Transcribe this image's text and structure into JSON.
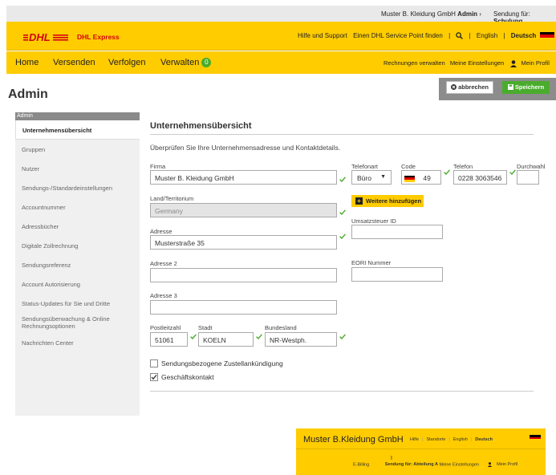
{
  "topbar": {
    "company_name": "Muster B. Kleidung GmbH",
    "company_role": "Admin",
    "chev": "›",
    "sendung_label": "Sendung für:",
    "sendung_value": "Schulung",
    "sendung_chev": "⌄"
  },
  "brand": {
    "product": "DHL Express",
    "links": {
      "help": "Hilfe und Support",
      "service_point": "Einen DHL Service Point finden",
      "sep": "|",
      "english": "English",
      "deutsch": "Deutsch"
    }
  },
  "nav": {
    "items": [
      {
        "label": "Home"
      },
      {
        "label": "Versenden"
      },
      {
        "label": "Verfolgen"
      },
      {
        "label": "Verwalten"
      }
    ],
    "badge": "0",
    "right": {
      "invoices": "Rechnungen verwalten",
      "settings": "Meine Einstellungen",
      "profile": "Mein Profil"
    }
  },
  "page": {
    "title": "Admin"
  },
  "actions": {
    "cancel": "abbrechen",
    "save": "Speichern"
  },
  "sidebar": {
    "header": "Admin",
    "items": [
      {
        "label": "Unternehmensübersicht"
      },
      {
        "label": "Gruppen"
      },
      {
        "label": "Nutzer"
      },
      {
        "label": "Sendungs-/Standardeinstellungen"
      },
      {
        "label": "Accountnummer"
      },
      {
        "label": "Adressbücher"
      },
      {
        "label": "Digitale Zollrechnung"
      },
      {
        "label": "Sendungsreferenz"
      },
      {
        "label": "Account Autorisierung"
      },
      {
        "label": "Status-Updates für Sie und Dritte"
      },
      {
        "label": "Sendungsüberwachung & Online Rechnungsoptionen"
      },
      {
        "label": "Nachrichten Center"
      }
    ]
  },
  "form": {
    "title": "Unternehmensübersicht",
    "intro": "Überprüfen Sie Ihre Unternehmensadresse und Kontaktdetails.",
    "firma": {
      "label": "Firma",
      "value": "Muster B. Kleidung GmbH"
    },
    "land": {
      "label": "Land/Territorium",
      "value": "Germany"
    },
    "adresse": {
      "label": "Adresse",
      "value": "Musterstraße 35"
    },
    "adresse2": {
      "label": "Adresse 2",
      "value": ""
    },
    "adresse3": {
      "label": "Adresse 3",
      "value": ""
    },
    "plz": {
      "label": "Postleitzahl",
      "value": "51061"
    },
    "stadt": {
      "label": "Stadt",
      "value": "KOELN"
    },
    "bundesland": {
      "label": "Bundesland",
      "value": "NR-Westph."
    },
    "telefonart": {
      "label": "Telefonart",
      "value": "Büro"
    },
    "code": {
      "label": "Code",
      "value": "49"
    },
    "telefon": {
      "label": "Telefon",
      "value": "0228 3063546"
    },
    "durchwahl": {
      "label": "Durchwahl",
      "value": ""
    },
    "add_more": "Weitere hinzufügen",
    "ust": {
      "label": "Umsatzsteuer ID",
      "value": ""
    },
    "eori": {
      "label": "EORI Nummer",
      "value": ""
    },
    "cb_notice": {
      "label": "Sendungsbezogene Zustellankündigung",
      "checked": false
    },
    "cb_business": {
      "label": "Geschäftskontakt",
      "checked": true
    }
  },
  "preview": {
    "title": "Muster B.Kleidung GmbH",
    "links": {
      "help": "Hilfe",
      "locations": "Standorte",
      "english": "English",
      "deutsch": "Deutsch"
    },
    "nav": {
      "ebilling": "E-Billing",
      "sendung": "Sendung für: Abteilung A",
      "settings": "Meine Einstellungen",
      "profile": "Mein Profil"
    }
  },
  "colors": {
    "dhl_yellow": "#ffcc00",
    "dhl_red": "#d40511",
    "green": "#4aac2d"
  }
}
